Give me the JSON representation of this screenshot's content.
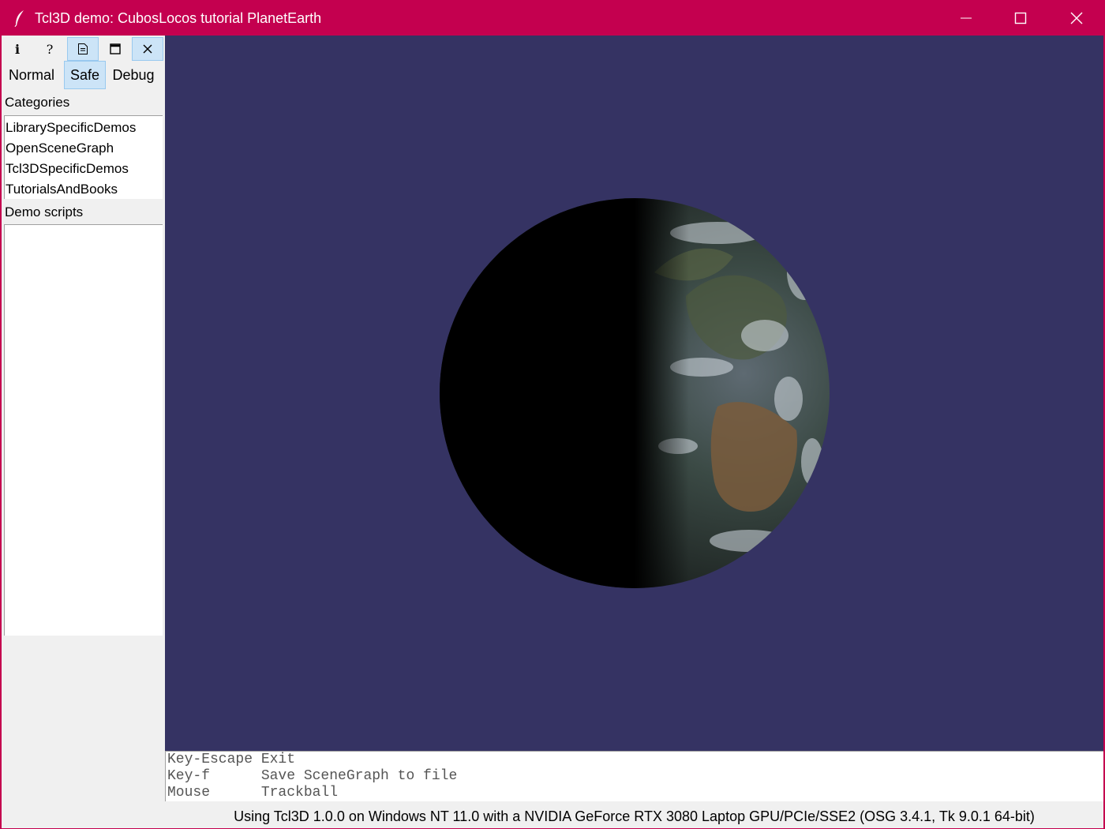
{
  "window": {
    "title": "Tcl3D demo: CubosLocos tutorial PlanetEarth",
    "title_bar_color": "#c4004f"
  },
  "toolbar": {
    "info_icon": "info-icon",
    "help_icon": "help-icon",
    "doc_icon": "document-icon",
    "maximize_icon": "maximize-icon",
    "close_icon": "close-icon"
  },
  "modes": {
    "normal": "Normal",
    "safe": "Safe",
    "debug": "Debug",
    "selected": "Safe"
  },
  "categories": {
    "label": "Categories",
    "items": [
      "LibrarySpecificDemos",
      "OpenSceneGraph",
      "Tcl3DSpecificDemos",
      "TutorialsAndBooks"
    ]
  },
  "scripts": {
    "label": "Demo scripts",
    "items": []
  },
  "view": {
    "background": "#353363",
    "object": "planet-earth"
  },
  "console": {
    "lines": [
      "Key-Escape Exit",
      "Key-f      Save SceneGraph to file",
      "Mouse      Trackball"
    ]
  },
  "status": {
    "text": "Using Tcl3D 1.0.0 on Windows NT 11.0 with a NVIDIA GeForce RTX 3080 Laptop GPU/PCIe/SSE2 (OSG 3.4.1, Tk 9.0.1 64-bit)"
  }
}
